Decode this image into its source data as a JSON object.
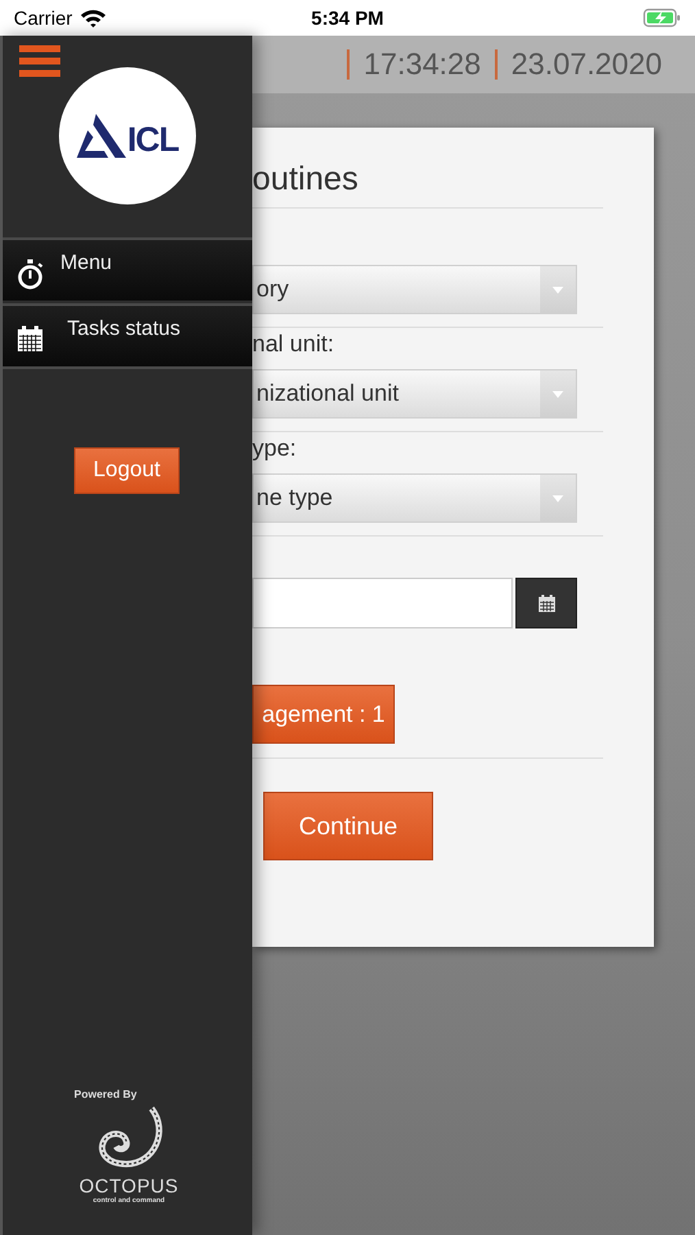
{
  "status_bar": {
    "carrier": "Carrier",
    "time": "5:34 PM"
  },
  "header": {
    "time": "17:34:28",
    "date": "23.07.2020"
  },
  "drawer": {
    "logo_text": "ICL",
    "items": [
      {
        "label": "Menu",
        "kind": "stopwatch"
      },
      {
        "label": "Tasks status",
        "kind": "calendar"
      }
    ],
    "logout": "Logout",
    "powered_by": "Powered By",
    "brand": "OCTOPUS",
    "tagline": "control and command"
  },
  "card": {
    "title": "outines",
    "fields": [
      {
        "kind": "select",
        "value": "ory"
      },
      {
        "kind": "select",
        "label": "nal unit:",
        "value": "nizational unit"
      },
      {
        "kind": "select",
        "label": "ype:",
        "value": "ne type"
      },
      {
        "kind": "date"
      }
    ],
    "management_button": "agement : 1",
    "continue_button": "Continue"
  }
}
